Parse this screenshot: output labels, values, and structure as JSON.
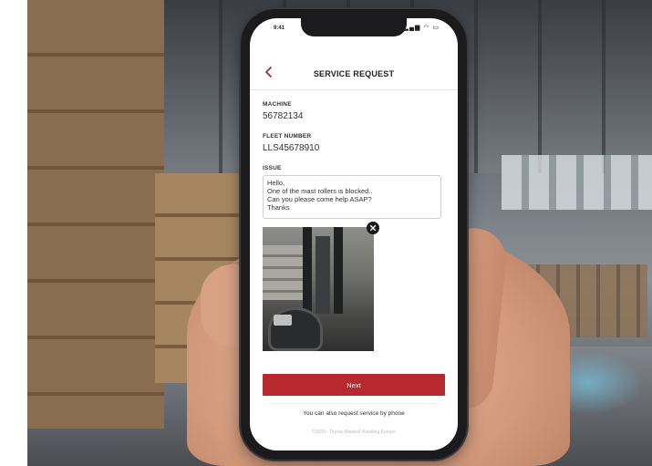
{
  "status_bar": {
    "time": "9:41",
    "icons": "▂▄▆ ◠ ▭"
  },
  "header": {
    "title": "SERVICE REQUEST"
  },
  "form": {
    "machine_label": "MACHINE",
    "machine_value": "56782134",
    "fleet_label": "FLEET NUMBER",
    "fleet_value": "LLS45678910",
    "issue_label": "ISSUE",
    "issue_lines": [
      "Hello,",
      "One of the mast rollers is blocked..",
      "Can you please come help ASAP?",
      "Thanks"
    ]
  },
  "attachment": {
    "close_glyph": "×"
  },
  "actions": {
    "next_label": "Next"
  },
  "footer": {
    "phone_note": "You can also request service by phone",
    "copyright": "©2020 - Toyota Material Handling Europe"
  },
  "colors": {
    "accent": "#b8282f",
    "back_arrow": "#9c2a4a"
  }
}
